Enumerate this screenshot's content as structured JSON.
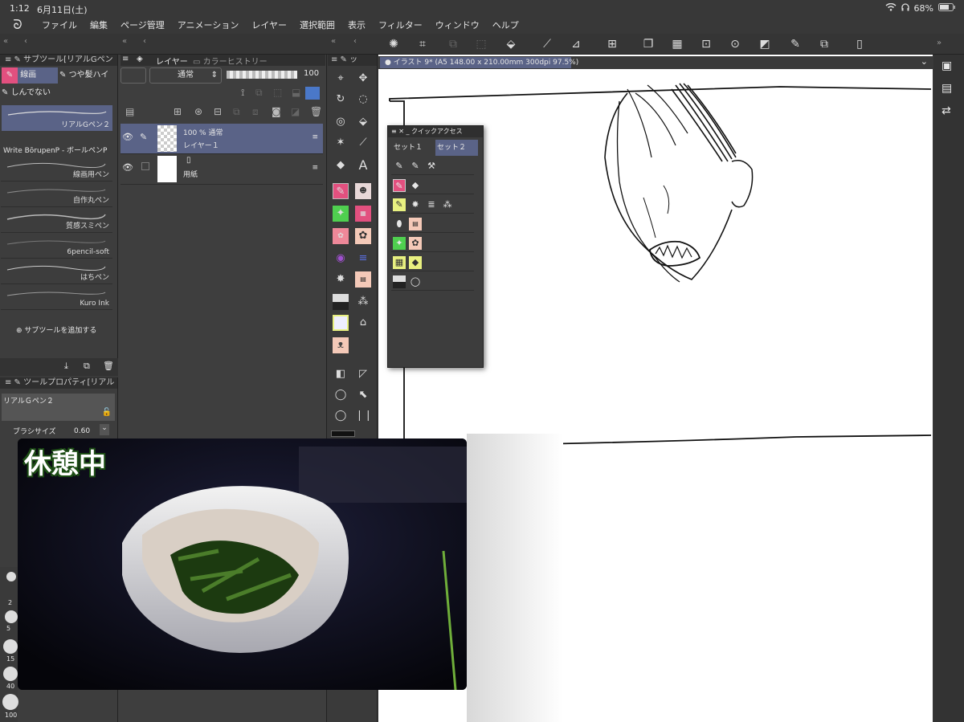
{
  "status": {
    "time": "1:12",
    "date": "6月11日(土)",
    "battery": "68%"
  },
  "menu": [
    "ファイル",
    "編集",
    "ページ管理",
    "アニメーション",
    "レイヤー",
    "選択範囲",
    "表示",
    "フィルター",
    "ウィンドウ",
    "ヘルプ"
  ],
  "subtool": {
    "header": "サブツール[リアルGペン",
    "tabs": [
      "線画",
      "つや髪ハイ",
      "しんでない"
    ],
    "selected_brush": "リアルGペン２",
    "brushes": [
      "Write BōrupenP - ボールペンP",
      "線画用ペン",
      "自作丸ペン",
      "質感スミペン",
      "6pencil-soft",
      "はちペン",
      "Kuro Ink"
    ],
    "add_label": "サブツールを追加する"
  },
  "toolprop": {
    "header": "ツールプロパティ[リアル",
    "name": "リアルＧペン２",
    "brush_size_label": "ブラシサイズ",
    "brush_size_value": "0.60"
  },
  "size_palette": [
    "2",
    "5",
    "10",
    "15",
    "40",
    "100"
  ],
  "layer_panel": {
    "tab_layer": "レイヤー",
    "tab_color_history": "カラーヒストリー",
    "blend_mode": "通常",
    "opacity": "100",
    "layers": [
      {
        "info": "100 % 通常",
        "name": "レイヤー１"
      },
      {
        "info": "",
        "name": "用紙"
      }
    ]
  },
  "canvas": {
    "tab": "イラスト 9* (A5 148.00 x 210.00mm 300dpi 97.5%)"
  },
  "quick_access": {
    "title": "クイックアクセス",
    "tabs": [
      "セット１",
      "セット２"
    ]
  },
  "video": {
    "overlay_text": "休憩中"
  },
  "colors": {
    "accent": "#e2507f",
    "selected": "#5a6387",
    "canvas": "#ffffff"
  }
}
